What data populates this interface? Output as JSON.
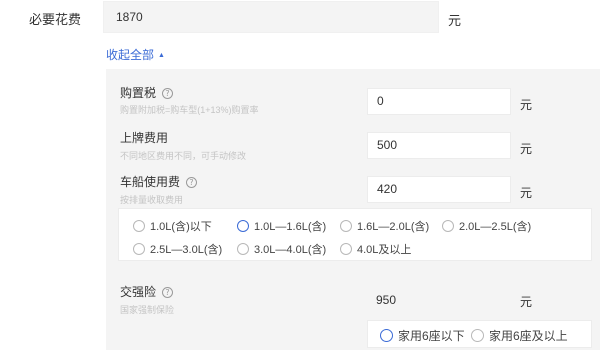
{
  "top": {
    "label": "必要花费",
    "value": "1870",
    "unit": "元"
  },
  "collapse": {
    "label": "收起全部",
    "indicator": "▲"
  },
  "help_glyph": "?",
  "items": [
    {
      "label": "购置税",
      "desc": "购置附加税=购车型(1+13%)购置率",
      "value": "0",
      "unit": "元"
    },
    {
      "label": "上牌费用",
      "desc": "不同地区费用不同，可手动修改",
      "value": "500",
      "unit": "元"
    },
    {
      "label": "车船使用费",
      "desc": "按排量收取费用",
      "value": "420",
      "unit": "元"
    },
    {
      "label": "交强险",
      "desc": "国家强制保险",
      "value": "950",
      "unit": "元"
    }
  ],
  "displacement_options": [
    "1.0L(含)以下",
    "1.0L—1.6L(含)",
    "1.6L—2.0L(含)",
    "2.0L—2.5L(含)",
    "2.5L—3.0L(含)",
    "3.0L—4.0L(含)",
    "4.0L及以上"
  ],
  "displacement_selected": "1.0L—1.6L(含)",
  "seat_options": [
    "家用6座以下",
    "家用6座及以上"
  ],
  "seat_selected": "家用6座以下",
  "colors": {
    "accent": "#3b6bd6",
    "panel_bg": "#f4f4f4"
  }
}
